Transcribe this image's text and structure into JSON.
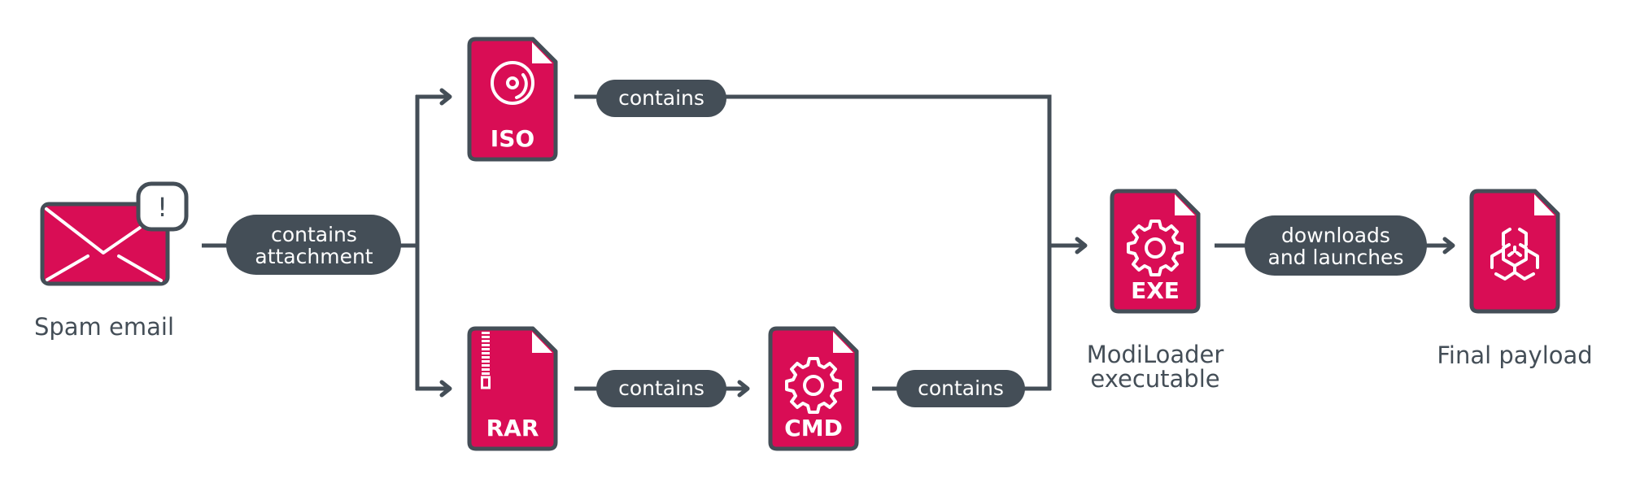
{
  "colors": {
    "accent": "#d90d55",
    "ink": "#444e57",
    "background": "#ffffff"
  },
  "nodes": {
    "spam_email": {
      "label": "Spam email",
      "icon": "envelope-alert-icon",
      "badge": "!"
    },
    "iso": {
      "label": "ISO",
      "icon": "disc-icon"
    },
    "rar": {
      "label": "RAR",
      "icon": "zip-archive-icon"
    },
    "cmd": {
      "label": "CMD",
      "icon": "gear-icon"
    },
    "exe": {
      "label": "EXE",
      "icon": "gear-icon",
      "caption_line1": "ModiLoader",
      "caption_line2": "executable"
    },
    "payload": {
      "icon": "biohazard-icon",
      "caption": "Final payload"
    }
  },
  "edges": {
    "email_to_attachments": {
      "line1": "contains",
      "line2": "attachment"
    },
    "iso_to_exe": {
      "label": "contains"
    },
    "rar_to_cmd": {
      "label": "contains"
    },
    "cmd_to_exe": {
      "label": "contains"
    },
    "exe_to_payload": {
      "line1": "downloads",
      "line2": "and launches"
    }
  }
}
